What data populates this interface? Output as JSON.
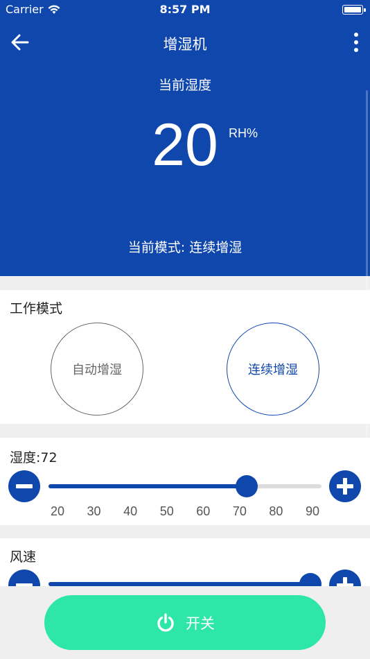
{
  "status_bar": {
    "carrier": "Carrier",
    "time": "8:57 PM"
  },
  "nav": {
    "title": "增湿机",
    "back_icon": "arrow-left-icon",
    "more_icon": "more-vertical-icon"
  },
  "current": {
    "label": "当前湿度",
    "value": "20",
    "unit": "RH%",
    "mode_text": "当前模式: 连续增湿"
  },
  "work_mode": {
    "title": "工作模式",
    "options": [
      {
        "label": "自动增湿",
        "selected": false
      },
      {
        "label": "连续增湿",
        "selected": true
      }
    ]
  },
  "humidity": {
    "title": "湿度:72",
    "value": 72,
    "min": 20,
    "max": 90,
    "ticks": [
      "20",
      "30",
      "40",
      "50",
      "60",
      "70",
      "80",
      "90"
    ]
  },
  "fan": {
    "title": "风速",
    "level": 1.0
  },
  "power": {
    "label": "开关",
    "icon": "power-icon"
  },
  "colors": {
    "primary": "#0f47ad",
    "accent": "#2ee6a8",
    "background": "#efefef"
  }
}
